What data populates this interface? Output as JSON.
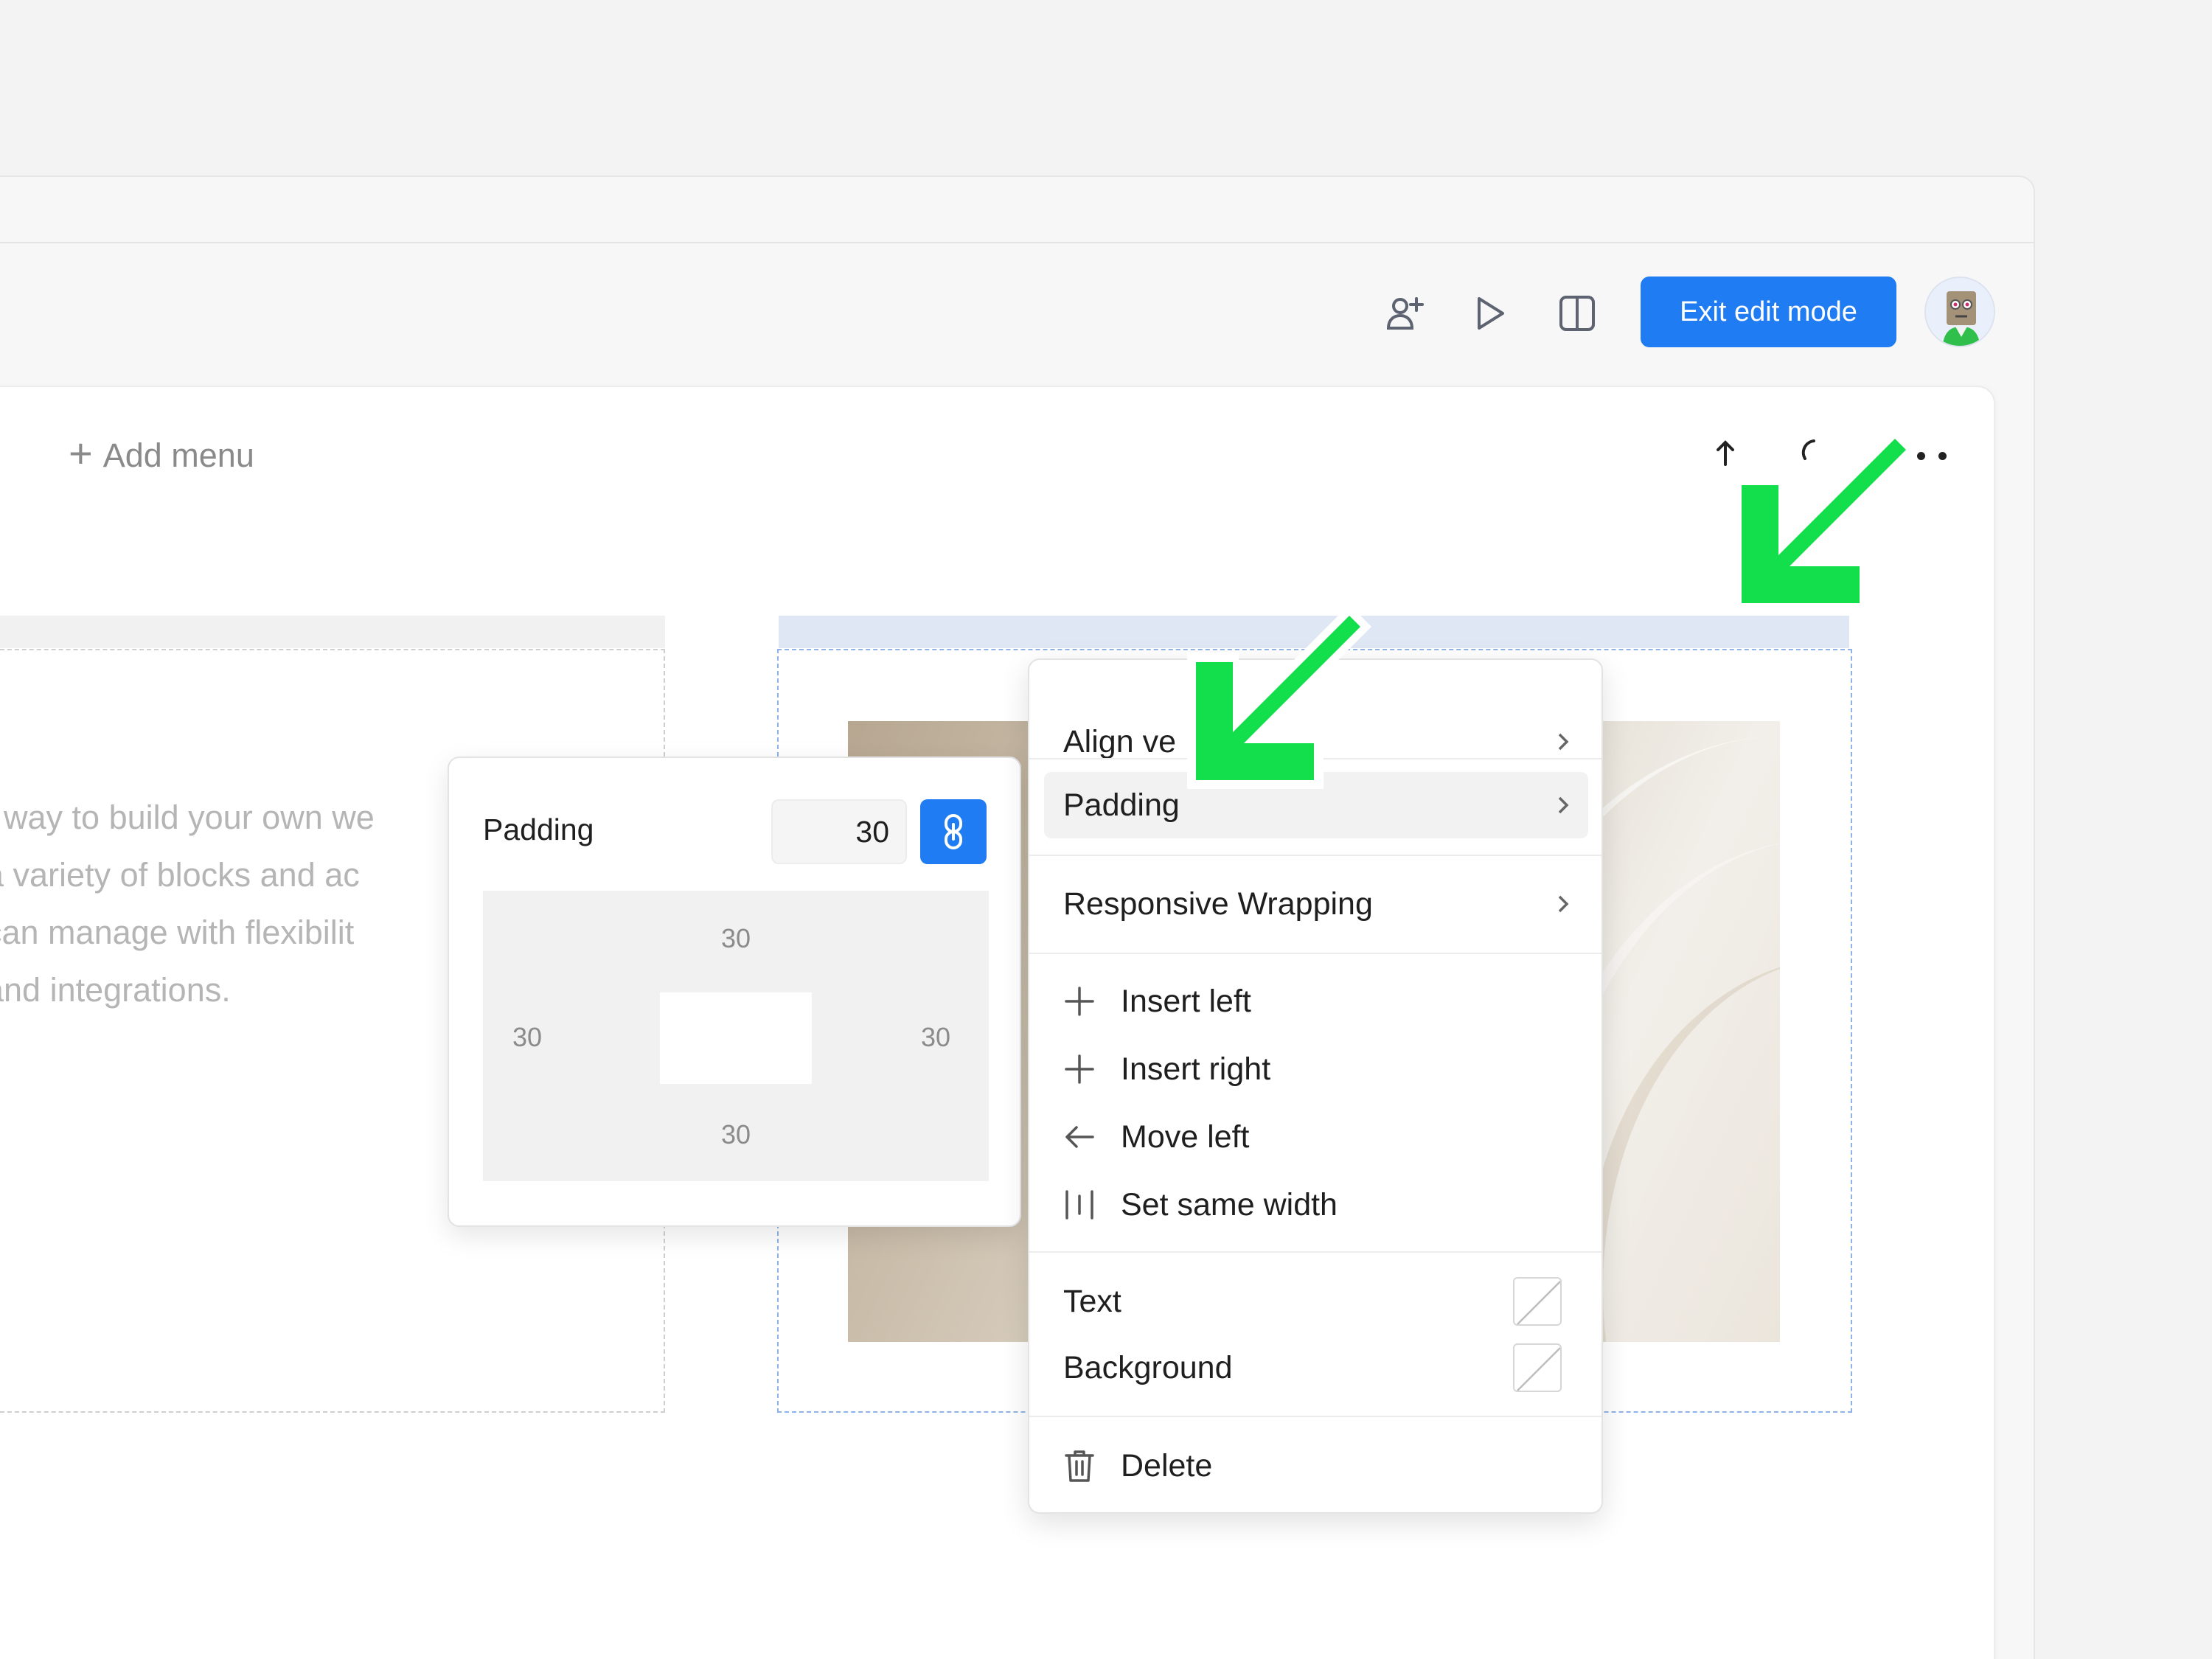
{
  "toolbar": {
    "exit_label": "Exit edit mode",
    "icons": [
      "add-user-icon",
      "play-icon",
      "split-view-icon"
    ]
  },
  "canvas": {
    "add_menu_label": "Add menu",
    "body_text_lines": [
      "t way to build your own we",
      "a variety of blocks and ac",
      " can manage with flexibilit",
      "and integrations."
    ]
  },
  "padding_popover": {
    "label": "Padding",
    "value": "30",
    "top": "30",
    "right": "30",
    "bottom": "30",
    "left": "30"
  },
  "context_menu": {
    "align": "Align ve",
    "padding": "Padding",
    "wrapping": "Responsive Wrapping",
    "insert_left": "Insert left",
    "insert_right": "Insert right",
    "move_left": "Move left",
    "same_width": "Set same width",
    "text": "Text",
    "background": "Background",
    "delete": "Delete"
  },
  "colors": {
    "primary": "#1f7cf2",
    "annotation_arrow": "#12df4b"
  }
}
